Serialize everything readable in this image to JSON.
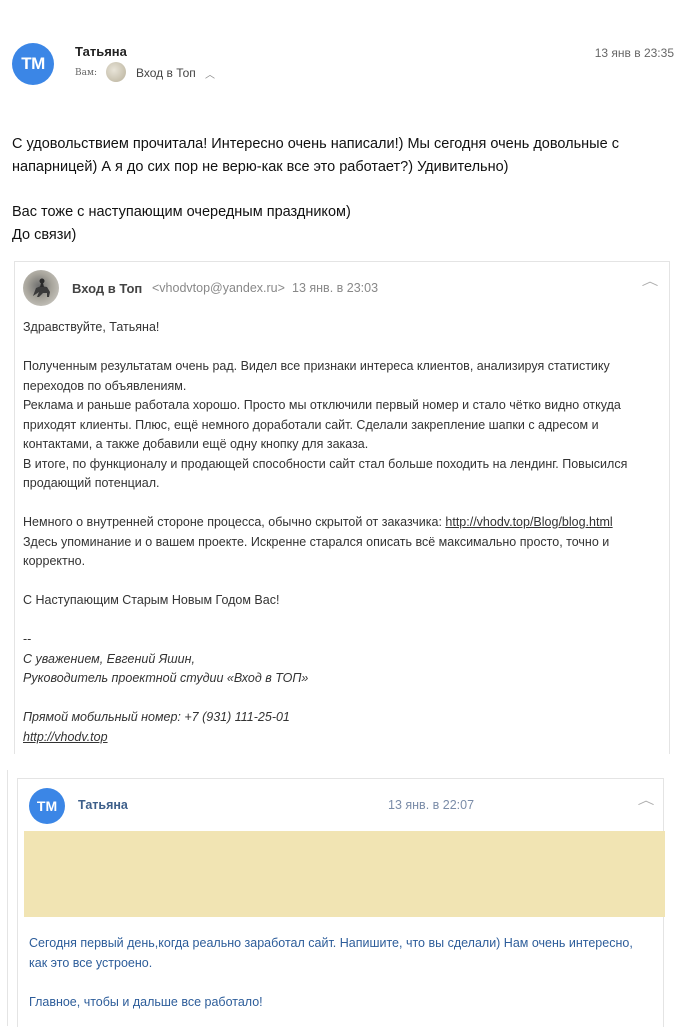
{
  "header": {
    "sender_initials": "ТМ",
    "sender_name": "Татьяна",
    "sent_time": "13 янв в 23:35",
    "to_label": "Вам:",
    "recipient_name": "Вход в Топ",
    "chevron_icon": "chevron-up-icon"
  },
  "message": {
    "para1": "С удовольствием прочитала! Интересно очень написали!)  Мы сегодня очень довольные с напарницей) А я до сих пор не верю-как все это работает?) Удивительно)",
    "para2_line1": "Вас тоже с наступающим очередным праздником)",
    "para2_line2": "До связи)"
  },
  "quote1": {
    "sender_name": "Вход в Топ",
    "sender_email": "<vhodvtop@yandex.ru>",
    "time": "13 янв. в 23:03",
    "collapse_icon": "chevron-up-icon",
    "greeting": "Здравствуйте, Татьяна!",
    "p1_line1": "Полученным результатам очень рад. Видел все признаки интереса клиентов, анализируя статистику",
    "p1_line2": "переходов по объявлениям.",
    "p1_line3": "Реклама и раньше работала хорошо. Просто мы отключили первый номер и стало чётко видно откуда",
    "p1_line4": "приходят клиенты. Плюс, ещё немного доработали сайт. Сделали закрепление шапки с адресом и",
    "p1_line5": "контактами, а также добавили ещё одну кнопку для заказа.",
    "p1_line6": "В итоге, по функционалу и продающей способности сайт стал больше походить на лендинг. Повысился",
    "p1_line7": "продающий потенциал.",
    "p2_prefix": "Немного о внутренней стороне процесса, обычно скрытой от заказчика: ",
    "p2_link": "http://vhodv.top/Blog/blog.html",
    "p2_line2": "Здесь упоминание и о вашем проекте. Искренне старался описать всё максимально просто, точно и",
    "p2_line3": "корректно.",
    "p3": "С Наступающим Старым Новым Годом Вас!",
    "sig_dash": "--",
    "sig_line1": "С уважением, Евгений Яшин,",
    "sig_line2": "Руководитель проектной студии «Вход в ТОП»",
    "sig_phone": "Прямой мобильный номер: +7 (931) 111-25-01",
    "sig_link": "http://vhodv.top"
  },
  "quote2": {
    "sender_initials": "ТМ",
    "sender_name": "Татьяна",
    "time": "13 янв. в 22:07",
    "collapse_icon": "chevron-up-icon",
    "line1": "Сегодня первый день,когда реально заработал сайт. Напишите, что вы сделали) Нам очень интересно,",
    "line2": "как это все устроено.",
    "line3": "Главное, чтобы и дальше все работало!"
  },
  "colors": {
    "avatar_blue": "#3b86e6",
    "highlight_yellow": "#f1e4b3",
    "quote2_text": "#2d5d9a"
  }
}
